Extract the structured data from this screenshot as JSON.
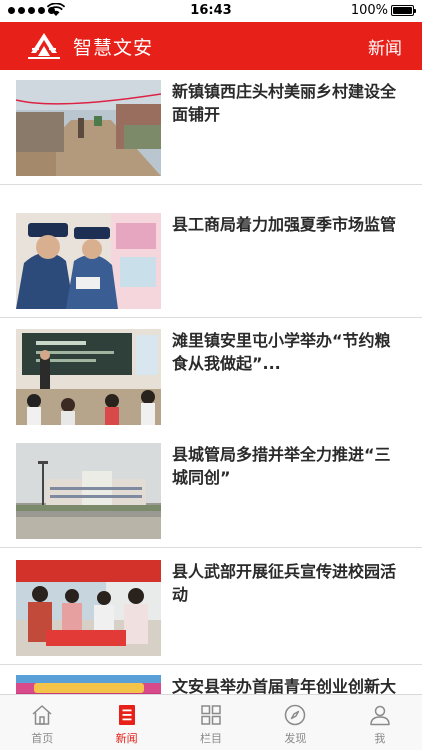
{
  "status_bar": {
    "time": "16:43",
    "battery": "100%"
  },
  "header": {
    "title": "智慧文安",
    "section": "新闻"
  },
  "colors": {
    "brand_red": "#e8201a",
    "tab_inactive": "#8a8a8a"
  },
  "news": [
    {
      "title": "新镇镇西庄头村美丽乡村建设全面铺开",
      "thumb": "village-street-photo"
    },
    {
      "title": "县工商局着力加强夏季市场监管",
      "thumb": "market-inspection-photo"
    },
    {
      "title": "滩里镇安里屯小学举办“节约粮食从我做起”...",
      "thumb": "classroom-photo"
    },
    {
      "title": "县城管局多措并举全力推进“三城同创”",
      "thumb": "city-building-photo"
    },
    {
      "title": "县人武部开展征兵宣传进校园活动",
      "thumb": "recruitment-booth-photo"
    },
    {
      "title": "文安县举办首届青年创业创新大",
      "thumb": "youth-event-photo"
    }
  ],
  "tabs": [
    {
      "label": "首页",
      "icon": "home-icon"
    },
    {
      "label": "新闻",
      "icon": "news-icon",
      "active": true
    },
    {
      "label": "栏目",
      "icon": "grid-icon"
    },
    {
      "label": "发现",
      "icon": "compass-icon"
    },
    {
      "label": "我",
      "icon": "user-icon"
    }
  ]
}
